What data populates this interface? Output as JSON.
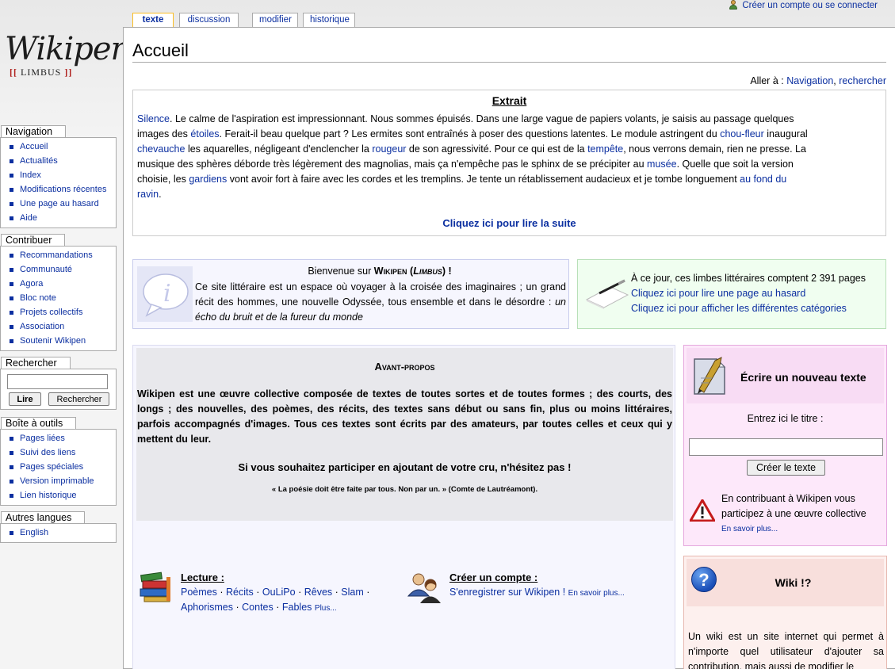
{
  "personal_tools": {
    "create_account": "Créer un compte ou se connecter"
  },
  "tabs": [
    {
      "label": "texte"
    },
    {
      "label": "discussion"
    },
    {
      "label": "modifier"
    },
    {
      "label": "historique"
    }
  ],
  "logo": {
    "word": "Wikipen",
    "sub_open": "[[",
    "sub": "LIMBUS",
    "sub_close": "]]"
  },
  "page": {
    "title": "Accueil",
    "goto_label": "Aller à :",
    "goto_nav": "Navigation",
    "goto_search": "rechercher"
  },
  "extrait": {
    "title": "Extrait",
    "more": "Cliquez ici pour lire la suite",
    "t1": "Silence",
    "t2": ". Le calme de l'aspiration est impressionnant. Nous sommes épuisés. Dans une large vague de papiers volants, je saisis au passage quelques images des ",
    "t3": "étoiles",
    "t4": ". Ferait-il beau quelque part ? Les ermites sont entraînés à poser des questions latentes. Le module astringent du ",
    "t5": "chou-fleur",
    "t6": " inaugural ",
    "t7": "chevauche",
    "t8": " les aquarelles, négligeant d'enclencher la ",
    "t9": "rougeur",
    "t10": " de son agressivité. Pour ce qui est de la ",
    "t11": "tempête",
    "t12": ", nous verrons demain, rien ne presse. La musique des sphères déborde très légèrement des magnolias, mais ça n'empêche pas le sphinx de se précipiter au ",
    "t13": "musée",
    "t14": ". Quelle que soit la version choisie, les ",
    "t15": "gardiens",
    "t16": " vont avoir fort à faire avec les cordes et les tremplins. Je tente un rétablissement audacieux et je tombe longuement ",
    "t17": "au fond du ravin",
    "t18": "."
  },
  "welcome": {
    "head_pre": "Bienvenue sur",
    "head_name": "Wikipen",
    "head_paren_open": "(",
    "head_limbus": "Limbus",
    "head_paren_close": ") !",
    "text": "Ce site littéraire est un espace où voyager à la croisée des imaginaires ; un grand récit des hommes, une nouvelle Odyssée, tous ensemble et dans le désordre :",
    "text_em": "un écho du bruit et de la fureur du monde"
  },
  "stats": {
    "line1": "À ce jour, ces limbes littéraires comptent 2 391 pages",
    "line2": "Cliquez ici pour lire une page au hasard",
    "line3": "Cliquez ici pour afficher les différentes catégories"
  },
  "avant": {
    "title": "Avant-propos",
    "text": "Wikipen est une œuvre collective composée de textes de toutes sortes et de toutes formes ; des courts, des longs ; des nouvelles, des poèmes, des récits, des textes sans début ou sans fin, plus ou moins littéraires, parfois accompagnés d'images. Tous ces textes sont écrits par des amateurs, par toutes celles et ceux qui y mettent du leur.",
    "invite": "Si vous souhaitez participer en ajoutant de votre cru, n'hésitez pas !",
    "quote": "« La poésie doit être faite par tous. Non par un. » (Comte de Lautréamont)."
  },
  "lecture": {
    "title": "Lecture :",
    "links": [
      "Poèmes",
      "Récits",
      "OuLiPo",
      "Rêves",
      "Slam",
      "Aphorismes",
      "Contes",
      "Fables"
    ],
    "sep": "·",
    "more": "Plus..."
  },
  "compte": {
    "title": "Créer un compte :",
    "link": "S'enregistrer sur Wikipen !",
    "more": "En savoir plus..."
  },
  "ecrire": {
    "title": "Écrire un nouveau texte",
    "label": "Entrez ici le titre :",
    "input_value": "",
    "button": "Créer le texte",
    "warn": "En contribuant à Wikipen vous participez à une œuvre collective",
    "warn_more": "En savoir plus..."
  },
  "wiki": {
    "title": "Wiki !?",
    "text": "Un wiki est un site internet qui permet à n'importe quel utilisateur d'ajouter sa contribution, mais aussi de modifier le"
  },
  "sidebar": {
    "navigation": {
      "title": "Navigation",
      "items": [
        "Accueil",
        "Actualités",
        "Index",
        "Modifications récentes",
        "Une page au hasard",
        "Aide"
      ]
    },
    "contribuer": {
      "title": "Contribuer",
      "items": [
        "Recommandations",
        "Communauté",
        "Agora",
        "Bloc note",
        "Projets collectifs",
        "Association",
        "Soutenir Wikipen"
      ]
    },
    "rechercher": {
      "title": "Rechercher",
      "input_value": "",
      "go": "Lire",
      "search": "Rechercher"
    },
    "outils": {
      "title": "Boîte à outils",
      "items": [
        "Pages liées",
        "Suivi des liens",
        "Pages spéciales",
        "Version imprimable",
        "Lien historique"
      ]
    },
    "langues": {
      "title": "Autres langues",
      "items": [
        "English"
      ]
    }
  }
}
